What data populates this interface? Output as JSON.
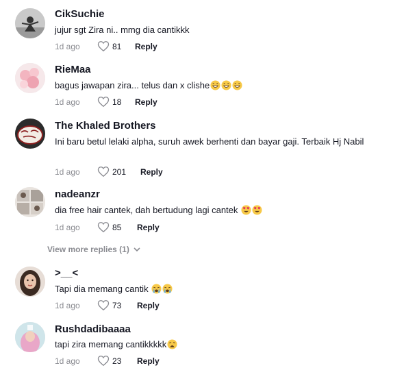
{
  "comments": [
    {
      "username": "CikSuchie",
      "text": "jujur sgt Zira ni.. mmg dia cantikkk",
      "emojis": [],
      "time": "1d ago",
      "likes": "81",
      "reply": "Reply",
      "avatar": "silhouette-avatar"
    },
    {
      "username": "RieMaa",
      "text": "bagus jawapan zira... telus dan x clishe",
      "emojis": [
        "grin-emoji",
        "grin-emoji",
        "grin-emoji"
      ],
      "time": "1d ago",
      "likes": "18",
      "reply": "Reply",
      "avatar": "pink-flower-avatar"
    },
    {
      "username": "The Khaled Brothers",
      "text": "Ini baru betul lelaki alpha, suruh awek berhenti dan bayar gaji. Terbaik Hj Nabil",
      "emojis": [],
      "time": "1d ago",
      "likes": "201",
      "reply": "Reply",
      "avatar": "cake-avatar"
    },
    {
      "username": "nadeanzr",
      "text": "dia free hair cantek, dah bertudung lagi cantek ",
      "emojis": [
        "heart-eyes-emoji",
        "heart-eyes-emoji"
      ],
      "time": "1d ago",
      "likes": "85",
      "reply": "Reply",
      "avatar": "collage-avatar"
    },
    {
      "username": ">__<",
      "text": "Tapi dia memang cantik ",
      "emojis": [
        "crying-emoji",
        "crying-emoji"
      ],
      "time": "1d ago",
      "likes": "73",
      "reply": "Reply",
      "avatar": "woman-portrait-avatar"
    },
    {
      "username": "Rushdadibaaaa",
      "text": "tapi zira memang cantikkkkk",
      "emojis": [
        "weary-emoji"
      ],
      "time": "1d ago",
      "likes": "23",
      "reply": "Reply",
      "avatar": "hijab-avatar"
    }
  ],
  "view_more": {
    "label": "View more replies (1)",
    "icon": "chevron-down-icon"
  },
  "colors": {
    "muted": "#8a8b91",
    "text": "#161823",
    "emoji": "#f7c948"
  }
}
